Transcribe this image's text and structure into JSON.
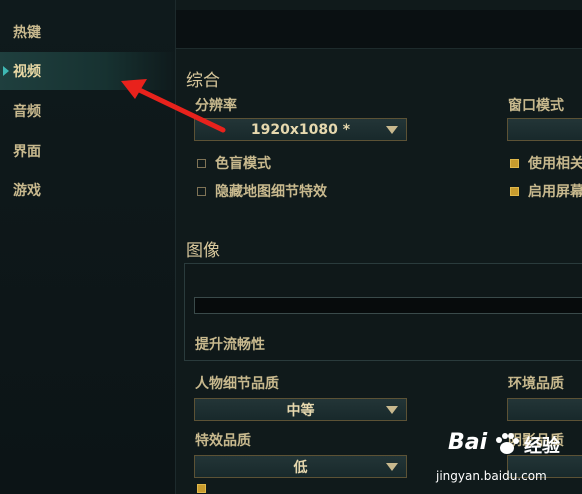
{
  "sidebar": {
    "items": [
      {
        "label": "热键",
        "active": false
      },
      {
        "label": "视频",
        "active": true
      },
      {
        "label": "音频",
        "active": false
      },
      {
        "label": "界面",
        "active": false
      },
      {
        "label": "游戏",
        "active": false
      }
    ]
  },
  "general": {
    "section_title": "综合",
    "resolution_label": "分辨率",
    "resolution_value": "1920x1080 *",
    "window_mode_label": "窗口模式",
    "window_mode_value": "",
    "colorblind_label": "色盲模式",
    "colorblind_checked": false,
    "hide_map_detail_label": "隐藏地图细节特效",
    "hide_map_detail_checked": false,
    "use_related_label": "使用相关",
    "use_related_checked": true,
    "enable_screen_label": "启用屏幕",
    "enable_screen_checked": true
  },
  "graphics": {
    "section_title": "图像",
    "smoothness_label": "提升流畅性",
    "character_quality_label": "人物细节品质",
    "character_quality_value": "中等",
    "environment_quality_label": "环境品质",
    "effects_quality_label": "特效品质",
    "effects_quality_value": "低",
    "shadow_quality_label": "阴影品质"
  },
  "watermark": {
    "brand": "Bai",
    "brand2": "经验",
    "url": "jingyan.baidu.com"
  },
  "colors": {
    "accent_teal": "#3fb8b4",
    "gold_text": "#c8b98e",
    "arrow_red": "#e8221c",
    "checkbox_gold": "#c89c2e"
  }
}
